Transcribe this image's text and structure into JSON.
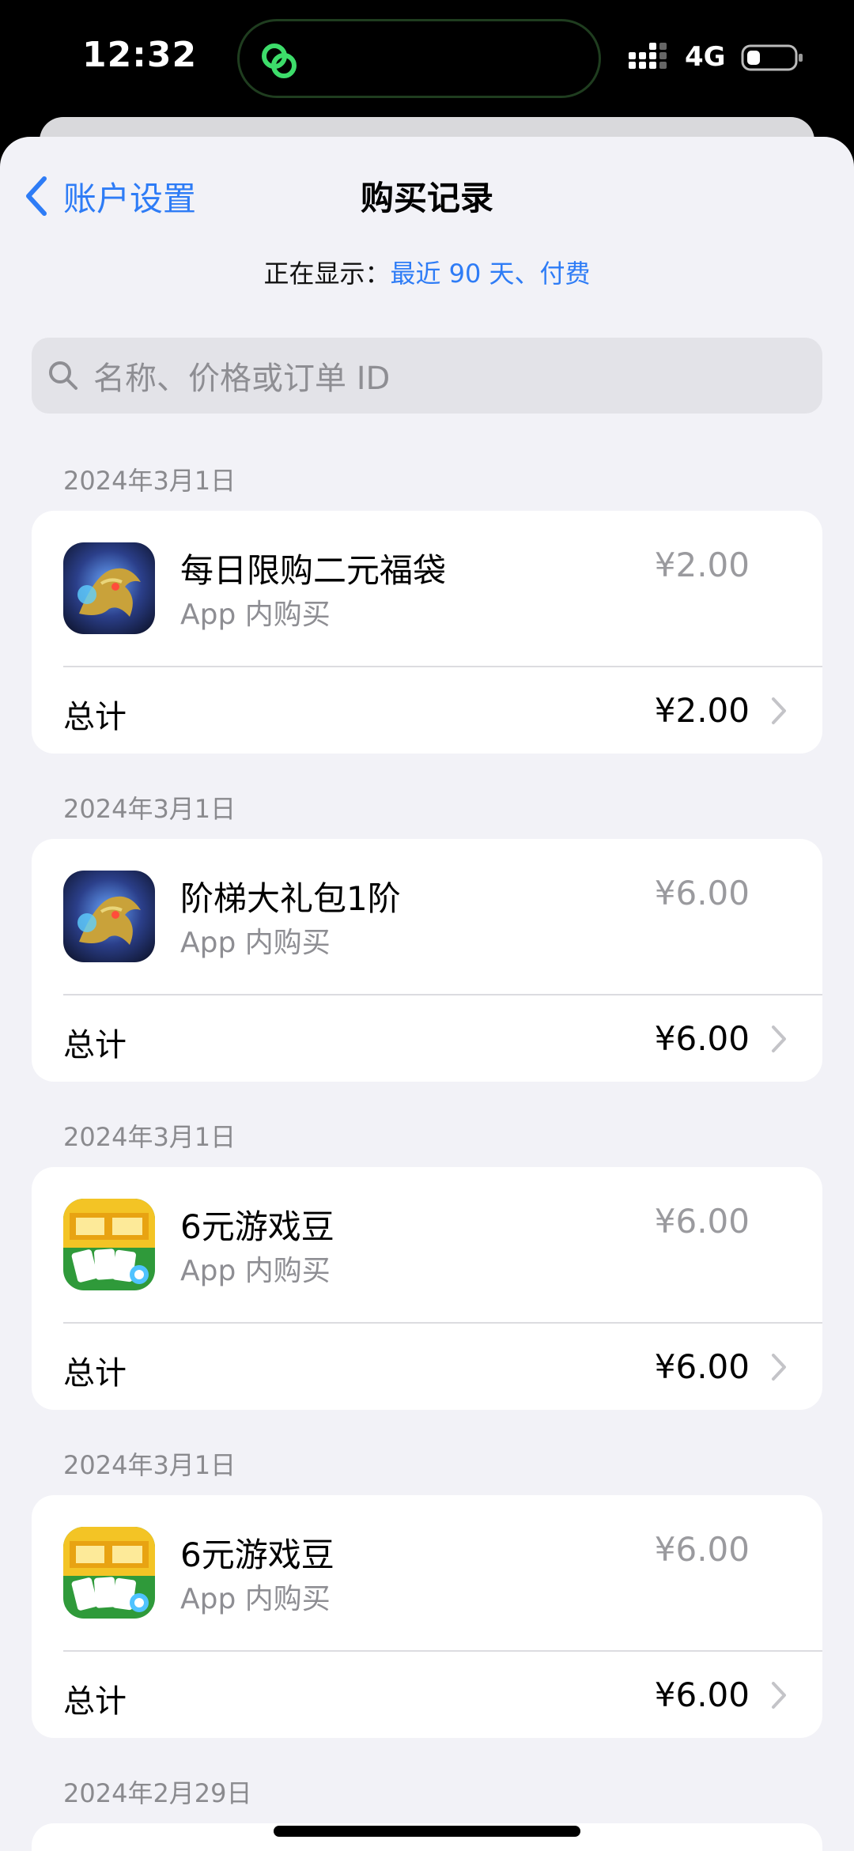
{
  "status": {
    "time": "12:32",
    "network": "4G"
  },
  "nav": {
    "back_label": "账户设置",
    "title": "购买记录"
  },
  "filter": {
    "label": "正在显示：",
    "value": "最近 90 天、付费"
  },
  "search": {
    "placeholder": "名称、价格或订单 ID"
  },
  "purchases": [
    {
      "date": "2024年3月1日",
      "name": "每日限购二元福袋",
      "type": "App 内购买",
      "price": "¥2.00",
      "total_label": "总计",
      "total": "¥2.00",
      "icon": "dragon-game-icon"
    },
    {
      "date": "2024年3月1日",
      "name": "阶梯大礼包1阶",
      "type": "App 内购买",
      "price": "¥6.00",
      "total_label": "总计",
      "total": "¥6.00",
      "icon": "dragon-game-icon"
    },
    {
      "date": "2024年3月1日",
      "name": "6元游戏豆",
      "type": "App 内购买",
      "price": "¥6.00",
      "total_label": "总计",
      "total": "¥6.00",
      "icon": "poker-game-icon"
    },
    {
      "date": "2024年3月1日",
      "name": "6元游戏豆",
      "type": "App 内购买",
      "price": "¥6.00",
      "total_label": "总计",
      "total": "¥6.00",
      "icon": "poker-game-icon"
    }
  ],
  "next_section": {
    "date": "2024年2月29日"
  },
  "colors": {
    "accent": "#2e7cf6",
    "background": "#f2f2f7",
    "secondary_text": "#8e8e93"
  }
}
